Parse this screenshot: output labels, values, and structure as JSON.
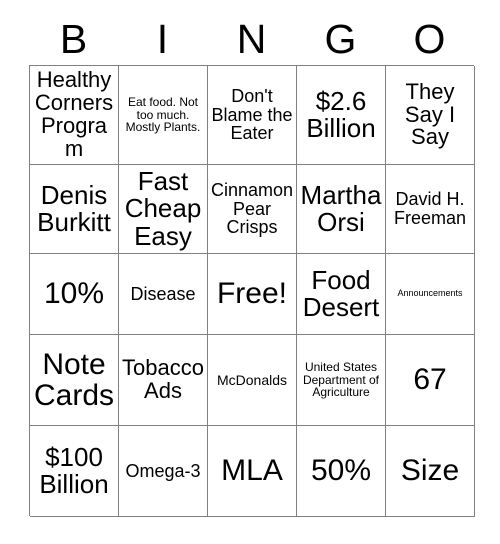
{
  "card": {
    "title": "BINGO",
    "grid_size": "5x5",
    "header_letters": [
      "B",
      "I",
      "N",
      "G",
      "O"
    ],
    "border_color": "#808080",
    "text_color": "#000000",
    "background_color": "#ffffff",
    "rows": [
      [
        {
          "text": "Healthy Corners Program",
          "size": "lg",
          "marked": false
        },
        {
          "text": "Eat food. Not too much. Mostly Plants.",
          "size": "xs",
          "marked": false
        },
        {
          "text": "Don't Blame the Eater",
          "size": "md",
          "marked": false
        },
        {
          "text": "$2.6 Billion",
          "size": "xl",
          "marked": false
        },
        {
          "text": "They Say I Say",
          "size": "lg",
          "marked": false
        }
      ],
      [
        {
          "text": "Denis Burkitt",
          "size": "xl",
          "marked": false
        },
        {
          "text": "Fast Cheap Easy",
          "size": "xl",
          "marked": false
        },
        {
          "text": "Cinnamon Pear Crisps",
          "size": "md",
          "marked": false
        },
        {
          "text": "Martha Orsi",
          "size": "xl",
          "marked": false
        },
        {
          "text": "David H. Freeman",
          "size": "md",
          "marked": false
        }
      ],
      [
        {
          "text": "10%",
          "size": "xxl",
          "marked": false
        },
        {
          "text": "Disease",
          "size": "md",
          "marked": false
        },
        {
          "text": "Free!",
          "size": "xxl",
          "marked": false
        },
        {
          "text": "Food Desert",
          "size": "xl",
          "marked": false
        },
        {
          "text": "Announcements",
          "size": "xxs",
          "marked": false
        }
      ],
      [
        {
          "text": "Note Cards",
          "size": "xxl",
          "marked": false
        },
        {
          "text": "Tobacco Ads",
          "size": "lg",
          "marked": false
        },
        {
          "text": "McDonalds",
          "size": "sm",
          "marked": false
        },
        {
          "text": "United States Department of Agriculture",
          "size": "xs",
          "marked": false
        },
        {
          "text": "67",
          "size": "xxl",
          "marked": false
        }
      ],
      [
        {
          "text": "$100 Billion",
          "size": "xl",
          "marked": false
        },
        {
          "text": "Omega-3",
          "size": "md",
          "marked": false
        },
        {
          "text": "MLA",
          "size": "xxl",
          "marked": false
        },
        {
          "text": "50%",
          "size": "xxl",
          "marked": false
        },
        {
          "text": "Size",
          "size": "xxl",
          "marked": false
        }
      ]
    ]
  }
}
